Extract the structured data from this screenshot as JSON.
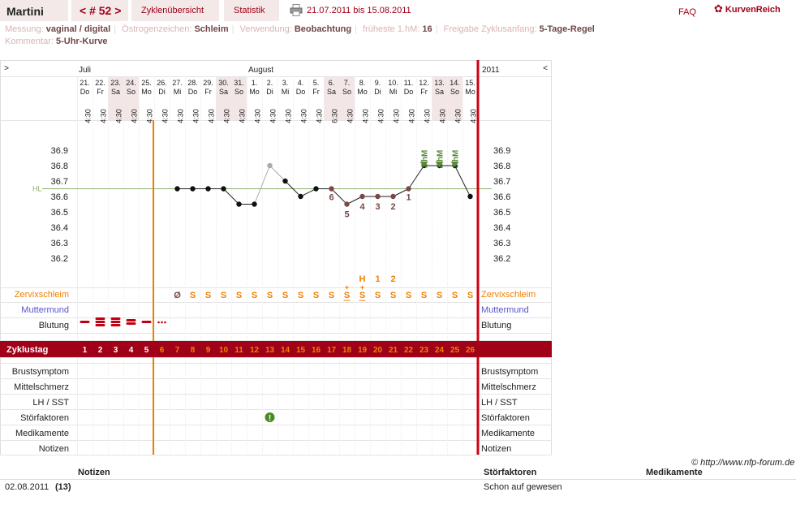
{
  "header": {
    "name": "Martini",
    "cycle": "< # 52 >",
    "tab_overview": "Zyklenübersicht",
    "tab_stats": "Statistik",
    "date_range": "21.07.2011 bis 15.08.2011",
    "faq": "FAQ",
    "brand": "KurvenReich"
  },
  "meta": {
    "messung_label": "Messung:",
    "messung_value": "vaginal / digital",
    "oestrogen_label": "Östrogenzeichen:",
    "oestrogen_value": "Schleim",
    "verwendung_label": "Verwendung:",
    "verwendung_value": "Beobachtung",
    "hm_label": "früheste 1.hM:",
    "hm_value": "16",
    "freigabe_label": "Freigabe Zyklusanfang:",
    "freigabe_value": "5-Tage-Regel",
    "kommentar_label": "Kommentar:",
    "kommentar_value": "5-Uhr-Kurve"
  },
  "nav": {
    "left": ">",
    "right": "<",
    "year": "2011"
  },
  "months": [
    {
      "label": "Juli",
      "col": 0
    },
    {
      "label": "August",
      "col": 11
    }
  ],
  "days": [
    {
      "d": "21.",
      "w": "Do",
      "t": "4:30"
    },
    {
      "d": "22.",
      "w": "Fr",
      "t": "4:30"
    },
    {
      "d": "23.",
      "w": "Sa",
      "t": "4:30"
    },
    {
      "d": "24.",
      "w": "So",
      "t": "4:30"
    },
    {
      "d": "25.",
      "w": "Mo",
      "t": "4:30"
    },
    {
      "d": "26.",
      "w": "Di",
      "t": "4:30"
    },
    {
      "d": "27.",
      "w": "Mi",
      "t": "4:30"
    },
    {
      "d": "28.",
      "w": "Do",
      "t": "4:30"
    },
    {
      "d": "29.",
      "w": "Fr",
      "t": "4:30"
    },
    {
      "d": "30.",
      "w": "Sa",
      "t": "4:30"
    },
    {
      "d": "31.",
      "w": "So",
      "t": "4:30"
    },
    {
      "d": "1.",
      "w": "Mo",
      "t": "4:30"
    },
    {
      "d": "2.",
      "w": "Di",
      "t": "4:30"
    },
    {
      "d": "3.",
      "w": "Mi",
      "t": "4:30"
    },
    {
      "d": "4.",
      "w": "Do",
      "t": "4:30"
    },
    {
      "d": "5.",
      "w": "Fr",
      "t": "4:30"
    },
    {
      "d": "6.",
      "w": "Sa",
      "t": "6:30"
    },
    {
      "d": "7.",
      "w": "So",
      "t": "4:30"
    },
    {
      "d": "8.",
      "w": "Mo",
      "t": "4:30"
    },
    {
      "d": "9.",
      "w": "Di",
      "t": "4:30"
    },
    {
      "d": "10.",
      "w": "Mi",
      "t": "4:30"
    },
    {
      "d": "11.",
      "w": "Do",
      "t": "4:30"
    },
    {
      "d": "12.",
      "w": "Fr",
      "t": "4:30"
    },
    {
      "d": "13.",
      "w": "Sa",
      "t": "4:30"
    },
    {
      "d": "14.",
      "w": "So",
      "t": "4:30"
    },
    {
      "d": "15.",
      "w": "Mo",
      "t": "4:30"
    }
  ],
  "shaded_cols": [
    2,
    3,
    9,
    10,
    16,
    17,
    23,
    24
  ],
  "chart_data": {
    "type": "line",
    "ylim": [
      36.1,
      37.0
    ],
    "yticks": [
      "36.2",
      "36.3",
      "36.4",
      "36.5",
      "36.6",
      "36.7",
      "36.8",
      "36.9"
    ],
    "hl_label": "HL",
    "hl_value": 36.65,
    "temps": [
      null,
      null,
      null,
      null,
      null,
      null,
      36.65,
      36.65,
      36.65,
      36.65,
      36.55,
      36.55,
      36.8,
      36.7,
      36.6,
      36.65,
      36.65,
      36.55,
      36.6,
      36.6,
      36.6,
      36.65,
      36.8,
      36.8,
      36.8,
      36.6
    ],
    "excluded": [
      12
    ],
    "pre_numbers": [
      {
        "col": 16,
        "label": "6"
      },
      {
        "col": 17,
        "label": "5"
      },
      {
        "col": 18,
        "label": "4"
      },
      {
        "col": 19,
        "label": "3"
      },
      {
        "col": 20,
        "label": "2"
      },
      {
        "col": 21,
        "label": "1"
      }
    ],
    "high_marks": [
      {
        "col": 22,
        "label": "1.hM"
      },
      {
        "col": 23,
        "label": "2.hM"
      },
      {
        "col": 24,
        "label": "3.hM"
      }
    ]
  },
  "rows": {
    "zervix": "Zervixschleim",
    "muttermund": "Muttermund",
    "blutung": "Blutung",
    "zyklustag": "Zyklustag",
    "brust": "Brustsymptom",
    "mittel": "Mittelschmerz",
    "lh": "LH / SST",
    "stoer": "Störfaktoren",
    "medi": "Medikamente",
    "notizen": "Notizen"
  },
  "mucus": [
    "",
    "",
    "",
    "",
    "",
    "",
    "Ø",
    "S",
    "S",
    "S",
    "S",
    "S",
    "S",
    "S",
    "S",
    "S",
    "S",
    "S+",
    "S+",
    "S",
    "S",
    "S",
    "S",
    "S",
    "S",
    "S"
  ],
  "mucus_tops": [
    {
      "col": 18,
      "label": "H"
    },
    {
      "col": 19,
      "label": "1"
    },
    {
      "col": 20,
      "label": "2"
    }
  ],
  "bleeding": [
    1,
    3,
    3,
    2,
    1,
    0.5
  ],
  "cycle_days": [
    "1",
    "2",
    "3",
    "4",
    "5",
    "6",
    "7",
    "8",
    "9",
    "10",
    "11",
    "12",
    "13",
    "14",
    "15",
    "16",
    "17",
    "18",
    "19",
    "20",
    "21",
    "22",
    "23",
    "24",
    "25",
    "26"
  ],
  "disturbance_col": 12,
  "copyright": "© http://www.nfp-forum.de",
  "notes": {
    "h_notes": "Notizen",
    "h_stoer": "Störfaktoren",
    "h_medi": "Medikamente",
    "date": "02.08.2011",
    "day": "(13)",
    "stoer_text": "Schon auf gewesen"
  },
  "colors": {
    "accent": "#a00018",
    "orange": "#f08000",
    "blue": "#5555cc",
    "shade": "#f3e6e6",
    "brown": "#7a4848",
    "green": "#5a8a3a"
  }
}
